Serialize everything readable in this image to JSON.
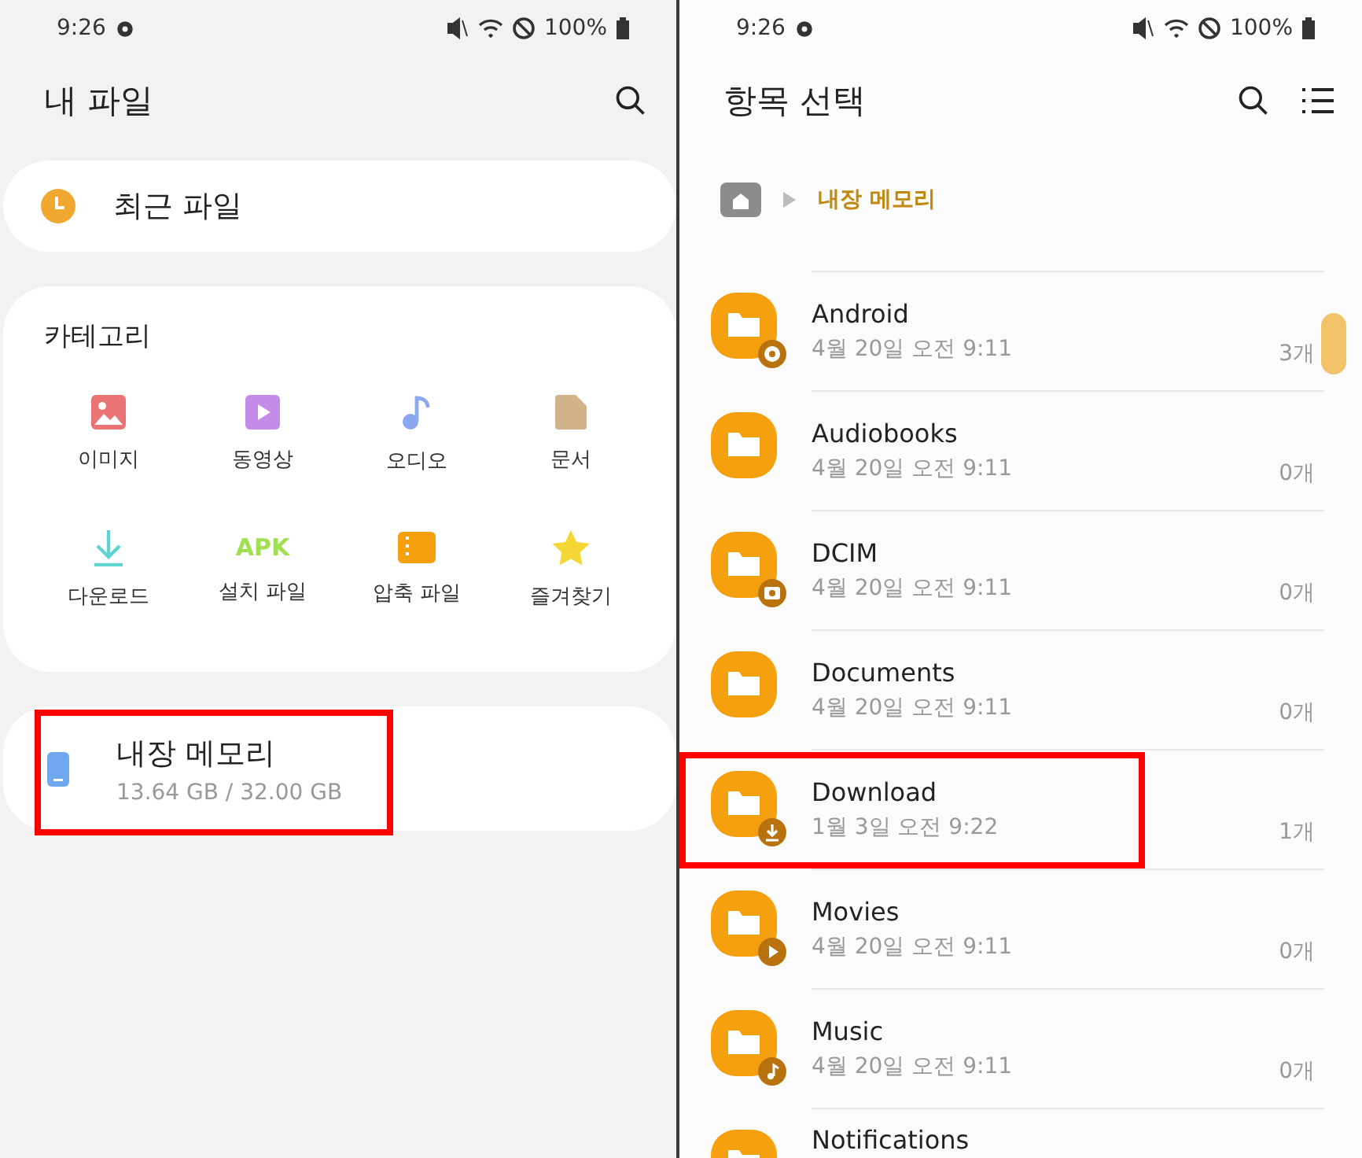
{
  "left": {
    "status_bar": {
      "time": "9:26",
      "battery": "100%"
    },
    "title": "내 파일",
    "recent": {
      "label": "최근 파일"
    },
    "categories": {
      "title": "카테고리",
      "items": [
        {
          "kind": "image",
          "label": "이미지"
        },
        {
          "kind": "video",
          "label": "동영상"
        },
        {
          "kind": "audio",
          "label": "오디오"
        },
        {
          "kind": "document",
          "label": "문서"
        },
        {
          "kind": "download",
          "label": "다운로드"
        },
        {
          "kind": "apk",
          "label": "설치 파일",
          "icon_text": "APK"
        },
        {
          "kind": "archive",
          "label": "압축 파일"
        },
        {
          "kind": "favorite",
          "label": "즐겨찾기"
        }
      ]
    },
    "storage": {
      "name": "내장 메모리",
      "usage": "13.64 GB / 32.00 GB",
      "highlighted": true
    }
  },
  "right": {
    "status_bar": {
      "time": "9:26",
      "battery": "100%"
    },
    "title": "항목 선택",
    "breadcrumb": {
      "current": "내장 메모리"
    },
    "folders": [
      {
        "name": "Android",
        "date": "4월 20일 오전 9:11",
        "count": "3개",
        "kind": "settings",
        "highlighted": false
      },
      {
        "name": "Audiobooks",
        "date": "4월 20일 오전 9:11",
        "count": "0개",
        "kind": "plain",
        "highlighted": false
      },
      {
        "name": "DCIM",
        "date": "4월 20일 오전 9:11",
        "count": "0개",
        "kind": "camera",
        "highlighted": false
      },
      {
        "name": "Documents",
        "date": "4월 20일 오전 9:11",
        "count": "0개",
        "kind": "plain",
        "highlighted": false
      },
      {
        "name": "Download",
        "date": "1월 3일 오전 9:22",
        "count": "1개",
        "kind": "download",
        "highlighted": true
      },
      {
        "name": "Movies",
        "date": "4월 20일 오전 9:11",
        "count": "0개",
        "kind": "play",
        "highlighted": false
      },
      {
        "name": "Music",
        "date": "4월 20일 오전 9:11",
        "count": "0개",
        "kind": "music",
        "highlighted": false
      },
      {
        "name": "Notifications",
        "kind": "plain",
        "highlighted": false
      }
    ]
  }
}
